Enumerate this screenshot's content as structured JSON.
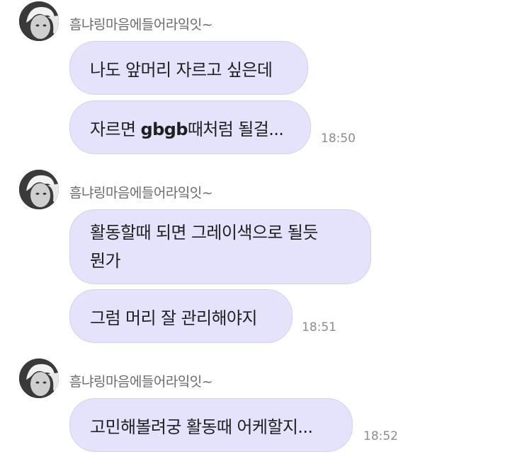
{
  "groups": [
    {
      "sender": "흠냐링마음에들어라잌잇~",
      "avatar_icon": "profile-photo-avatar",
      "messages": [
        {
          "text": "나도 앞머리 자르고 싶은데"
        },
        {
          "text_before": "자르면 ",
          "text_bold": "gbgb",
          "text_after": "때처럼 될걸..."
        }
      ],
      "time": "18:50"
    },
    {
      "sender": "흠냐링마음에들어라잌잇~",
      "avatar_icon": "profile-photo-avatar",
      "messages": [
        {
          "line1": "활동할때 되면 그레이색으로 될듯",
          "line2": "뭔가"
        },
        {
          "text": "그럼 머리 잘 관리해야지"
        }
      ],
      "time": "18:51"
    },
    {
      "sender": "흠냐링마음에들어라잌잇~",
      "avatar_icon": "profile-photo-avatar",
      "messages": [
        {
          "text": "고민해볼려궁 활동때 어케할지..."
        }
      ],
      "time": "18:52"
    }
  ],
  "colors": {
    "bubble": "#e4e3fb",
    "bubble_border": "#d3d1f2",
    "sender_text": "#6b6b6b",
    "time_text": "#8c8c8c"
  }
}
